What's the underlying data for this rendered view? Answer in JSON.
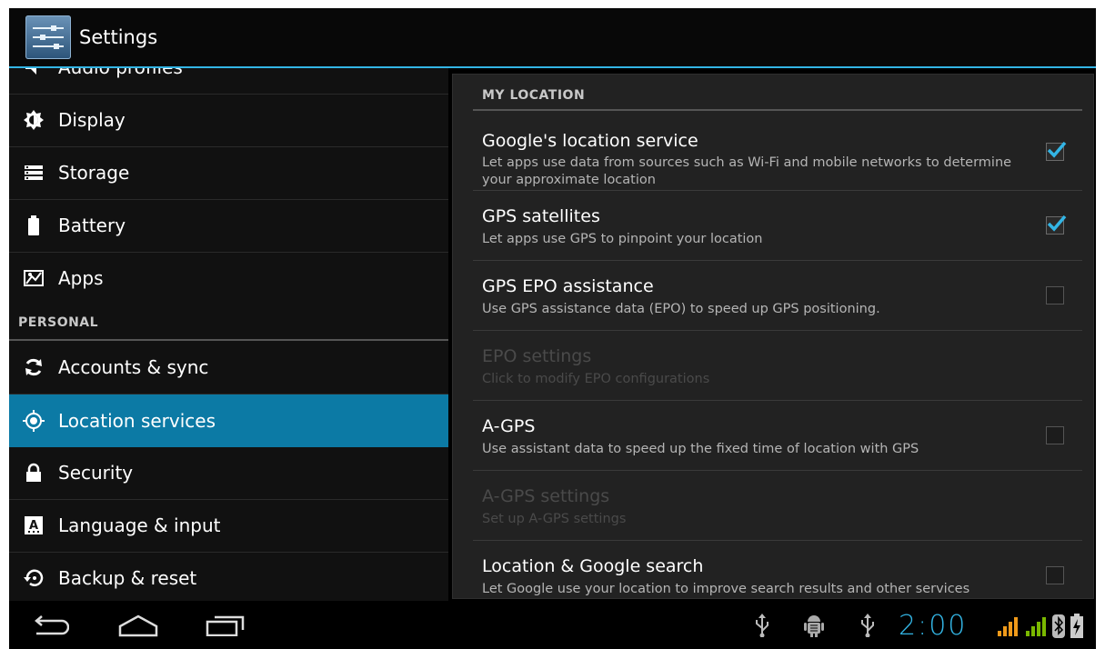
{
  "action_bar": {
    "title": "Settings"
  },
  "sidebar": {
    "items_top": [
      {
        "label": "Audio profiles"
      },
      {
        "label": "Display"
      },
      {
        "label": "Storage"
      },
      {
        "label": "Battery"
      },
      {
        "label": "Apps"
      }
    ],
    "section_personal": "PERSONAL",
    "items_personal": [
      {
        "label": "Accounts & sync"
      },
      {
        "label": "Location services",
        "selected": true
      },
      {
        "label": "Security"
      },
      {
        "label": "Language & input"
      },
      {
        "label": "Backup & reset"
      }
    ]
  },
  "main": {
    "section_title": "MY LOCATION",
    "rows": [
      {
        "title": "Google's location service",
        "summary": "Let apps use data from sources such as Wi-Fi and mobile networks to determine your approximate location",
        "checked": true,
        "enabled": true
      },
      {
        "title": "GPS satellites",
        "summary": "Let apps use GPS to pinpoint your location",
        "checked": true,
        "enabled": true
      },
      {
        "title": "GPS EPO assistance",
        "summary": "Use GPS assistance data (EPO) to speed up GPS positioning.",
        "checked": false,
        "enabled": true
      },
      {
        "title": "EPO settings",
        "summary": "Click to modify EPO configurations",
        "enabled": false
      },
      {
        "title": "A-GPS",
        "summary": "Use assistant data to speed up the fixed time of location with GPS",
        "checked": false,
        "enabled": true
      },
      {
        "title": "A-GPS settings",
        "summary": "Set up A-GPS settings",
        "enabled": false
      },
      {
        "title": "Location & Google search",
        "summary": "Let Google use your location to improve search results and other services",
        "checked": false,
        "enabled": true
      }
    ]
  },
  "status_bar": {
    "clock": "2:00",
    "icons": [
      "usb-icon",
      "android-debug-icon",
      "usb-icon",
      "signal-orange-icon",
      "signal-green-icon",
      "bluetooth-icon",
      "battery-charging-icon"
    ]
  },
  "nav_buttons": [
    "back-button",
    "home-button",
    "recent-apps-button"
  ],
  "colors": {
    "accent": "#33b5e5",
    "selected": "#0c7aa5",
    "signal_orange": "#f09a1a",
    "signal_green": "#7ab800"
  }
}
